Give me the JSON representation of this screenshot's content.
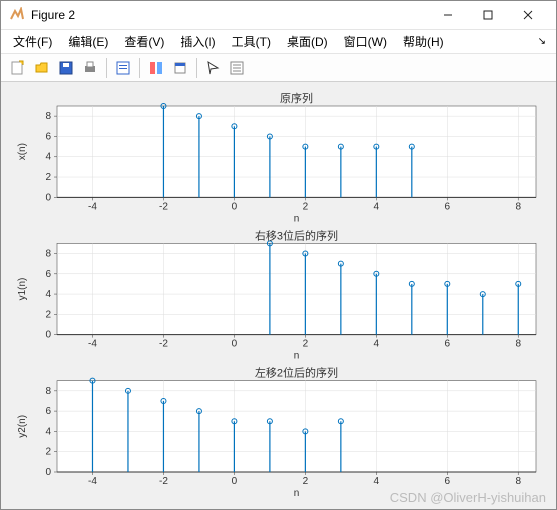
{
  "window": {
    "title": "Figure 2"
  },
  "menu": {
    "file": "文件(F)",
    "edit": "编辑(E)",
    "view": "查看(V)",
    "insert": "插入(I)",
    "tools": "工具(T)",
    "desktop": "桌面(D)",
    "window": "窗口(W)",
    "help": "帮助(H)"
  },
  "watermark": "CSDN @OliverH-yishuihan",
  "chart_data": [
    {
      "type": "stem",
      "title": "原序列",
      "xlabel": "n",
      "ylabel": "x(n)",
      "xlim": [
        -5,
        8.5
      ],
      "ylim": [
        0,
        9
      ],
      "xticks": [
        -4,
        -2,
        0,
        2,
        4,
        6,
        8
      ],
      "yticks": [
        0,
        2,
        4,
        6,
        8
      ],
      "x": [
        -2,
        -1,
        0,
        1,
        2,
        3,
        4,
        5
      ],
      "y": [
        9,
        8,
        7,
        6,
        5,
        5,
        5,
        5
      ]
    },
    {
      "type": "stem",
      "title": "右移3位后的序列",
      "xlabel": "n",
      "ylabel": "y1(n)",
      "xlim": [
        -5,
        8.5
      ],
      "ylim": [
        0,
        9
      ],
      "xticks": [
        -4,
        -2,
        0,
        2,
        4,
        6,
        8
      ],
      "yticks": [
        0,
        2,
        4,
        6,
        8
      ],
      "x": [
        1,
        2,
        3,
        4,
        5,
        6,
        7,
        8
      ],
      "y": [
        9,
        8,
        7,
        6,
        5,
        5,
        4,
        5
      ]
    },
    {
      "type": "stem",
      "title": "左移2位后的序列",
      "xlabel": "n",
      "ylabel": "y2(n)",
      "xlim": [
        -5,
        8.5
      ],
      "ylim": [
        0,
        9
      ],
      "xticks": [
        -4,
        -2,
        0,
        2,
        4,
        6,
        8
      ],
      "yticks": [
        0,
        2,
        4,
        6,
        8
      ],
      "x": [
        -4,
        -3,
        -2,
        -1,
        0,
        1,
        2,
        3
      ],
      "y": [
        9,
        8,
        7,
        6,
        5,
        5,
        4,
        5
      ]
    }
  ]
}
